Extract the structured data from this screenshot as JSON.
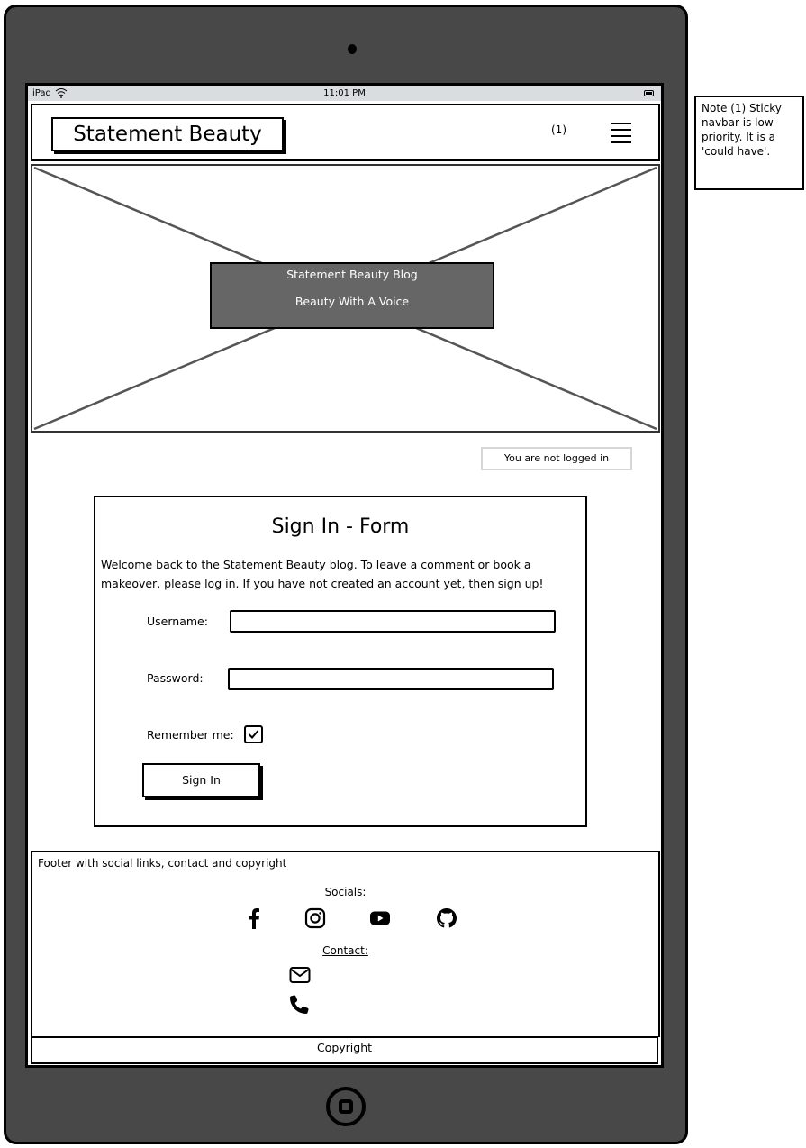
{
  "device": {
    "status_bar": {
      "carrier": "iPad",
      "time": "11:01 PM"
    }
  },
  "navbar": {
    "brand": "Statement Beauty",
    "note_ref": "(1)",
    "menu_icon": "hamburger-icon"
  },
  "hero": {
    "title": "Statement Beauty Blog",
    "tagline": "Beauty With A Voice"
  },
  "login_status": "You are not logged in",
  "form": {
    "title": "Sign In - Form",
    "intro": "Welcome back to the Statement Beauty blog. To leave a comment or book a makeover, please log in. If you have not created an account yet, then sign up!",
    "username_label": "Username:",
    "username_value": "",
    "password_label": "Password:",
    "password_value": "",
    "remember_label": "Remember me:",
    "remember_checked": true,
    "submit_label": "Sign In"
  },
  "footer": {
    "description": "Footer with social links, contact and copyright",
    "socials_heading": "Socials:",
    "socials": [
      {
        "name": "Facebook",
        "icon": "facebook-icon"
      },
      {
        "name": "Instagram",
        "icon": "instagram-icon"
      },
      {
        "name": "YouTube",
        "icon": "youtube-icon"
      },
      {
        "name": "GitHub",
        "icon": "github-icon"
      }
    ],
    "contact_heading": "Contact:",
    "contact": [
      {
        "name": "Email",
        "icon": "envelope-icon"
      },
      {
        "name": "Phone",
        "icon": "phone-icon"
      }
    ],
    "copyright": "Copyright"
  },
  "annotation": {
    "note": "Note (1) Sticky navbar is low priority. It is a 'could have'."
  },
  "colors": {
    "device_frame": "#484848",
    "status_bar": "#d9dde0",
    "hero_box": "#666666"
  }
}
